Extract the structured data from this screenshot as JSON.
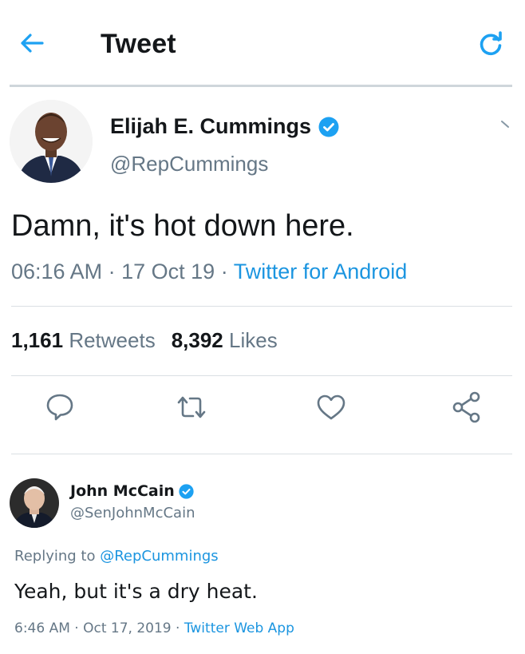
{
  "header": {
    "title": "Tweet",
    "back_icon": "arrow-left-icon",
    "refresh_icon": "refresh-icon"
  },
  "tweet": {
    "author_name": "Elijah E. Cummings",
    "author_handle": "@RepCummings",
    "text": "Damn, it's hot down here.",
    "time": "06:16 AM",
    "date": "17 Oct 19",
    "source": "Twitter for Android",
    "retweets_count": "1,161",
    "retweets_label": "Retweets",
    "likes_count": "8,392",
    "likes_label": "Likes"
  },
  "actions": {
    "reply_icon": "reply-icon",
    "retweet_icon": "retweet-icon",
    "like_icon": "heart-icon",
    "share_icon": "share-icon"
  },
  "reply": {
    "author_name": "John McCain",
    "author_handle": "@SenJohnMcCain",
    "replying_prefix": "Replying to",
    "replying_to": "@RepCummings",
    "text": "Yeah, but it's a dry heat.",
    "time": "6:46 AM",
    "date": "Oct 17, 2019",
    "source": "Twitter Web App"
  },
  "colors": {
    "accent": "#1da1f2",
    "link": "#1b95e0",
    "text_primary": "#14171a",
    "text_secondary": "#657786",
    "divider": "#dadfe3"
  }
}
